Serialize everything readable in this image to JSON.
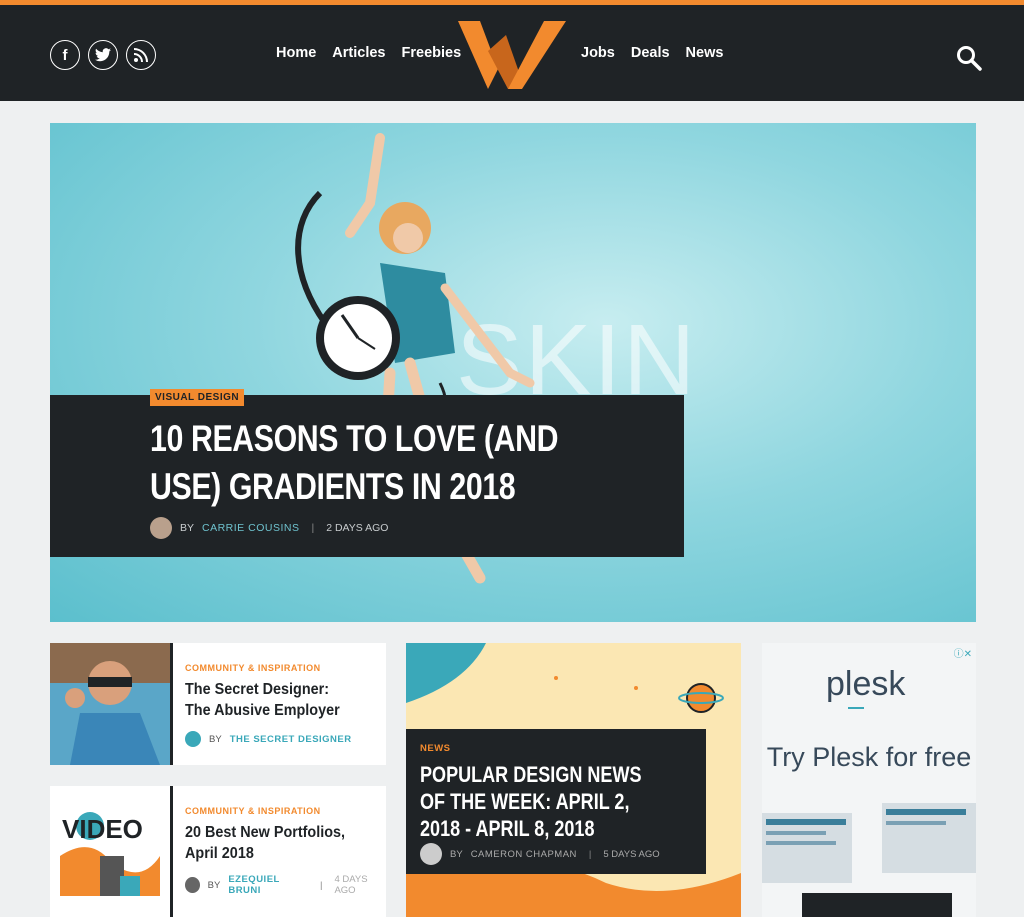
{
  "colors": {
    "accent": "#f28a2e",
    "header_bg": "#1f2326",
    "teal": "#3aa8b9"
  },
  "social": {
    "icons": [
      "facebook-icon",
      "twitter-icon",
      "rss-icon"
    ],
    "fb": "f"
  },
  "nav": {
    "left": [
      "Home",
      "Articles",
      "Freebies"
    ],
    "right": [
      "Jobs",
      "Deals",
      "News"
    ]
  },
  "hero": {
    "category": "VISUAL DESIGN",
    "title": "10 REASONS TO LOVE (AND USE) GRADIENTS IN 2018",
    "by": "BY",
    "author": "CARRIE COUSINS",
    "time": "2 DAYS AGO",
    "watermark": "SKIN"
  },
  "cards": [
    {
      "category": "COMMUNITY & INSPIRATION",
      "title": "The Secret Designer: The Abusive Employer",
      "by": "BY",
      "author": "THE SECRET DESIGNER",
      "time": ""
    },
    {
      "category": "COMMUNITY & INSPIRATION",
      "title": "20 Best New Portfolios, April 2018",
      "by": "BY",
      "author": "EZEQUIEL BRUNI",
      "time": "4 DAYS AGO",
      "thumb_text": "VIDEO"
    }
  ],
  "feature": {
    "category": "NEWS",
    "title": "POPULAR DESIGN NEWS OF THE WEEK: APRIL 2, 2018 - APRIL 8, 2018",
    "by": "BY",
    "author": "CAMERON CHAPMAN",
    "time": "5 DAYS AGO"
  },
  "ad": {
    "choices": "ⓘ✕",
    "brand": "plesk",
    "cta": "Try Plesk for free"
  }
}
